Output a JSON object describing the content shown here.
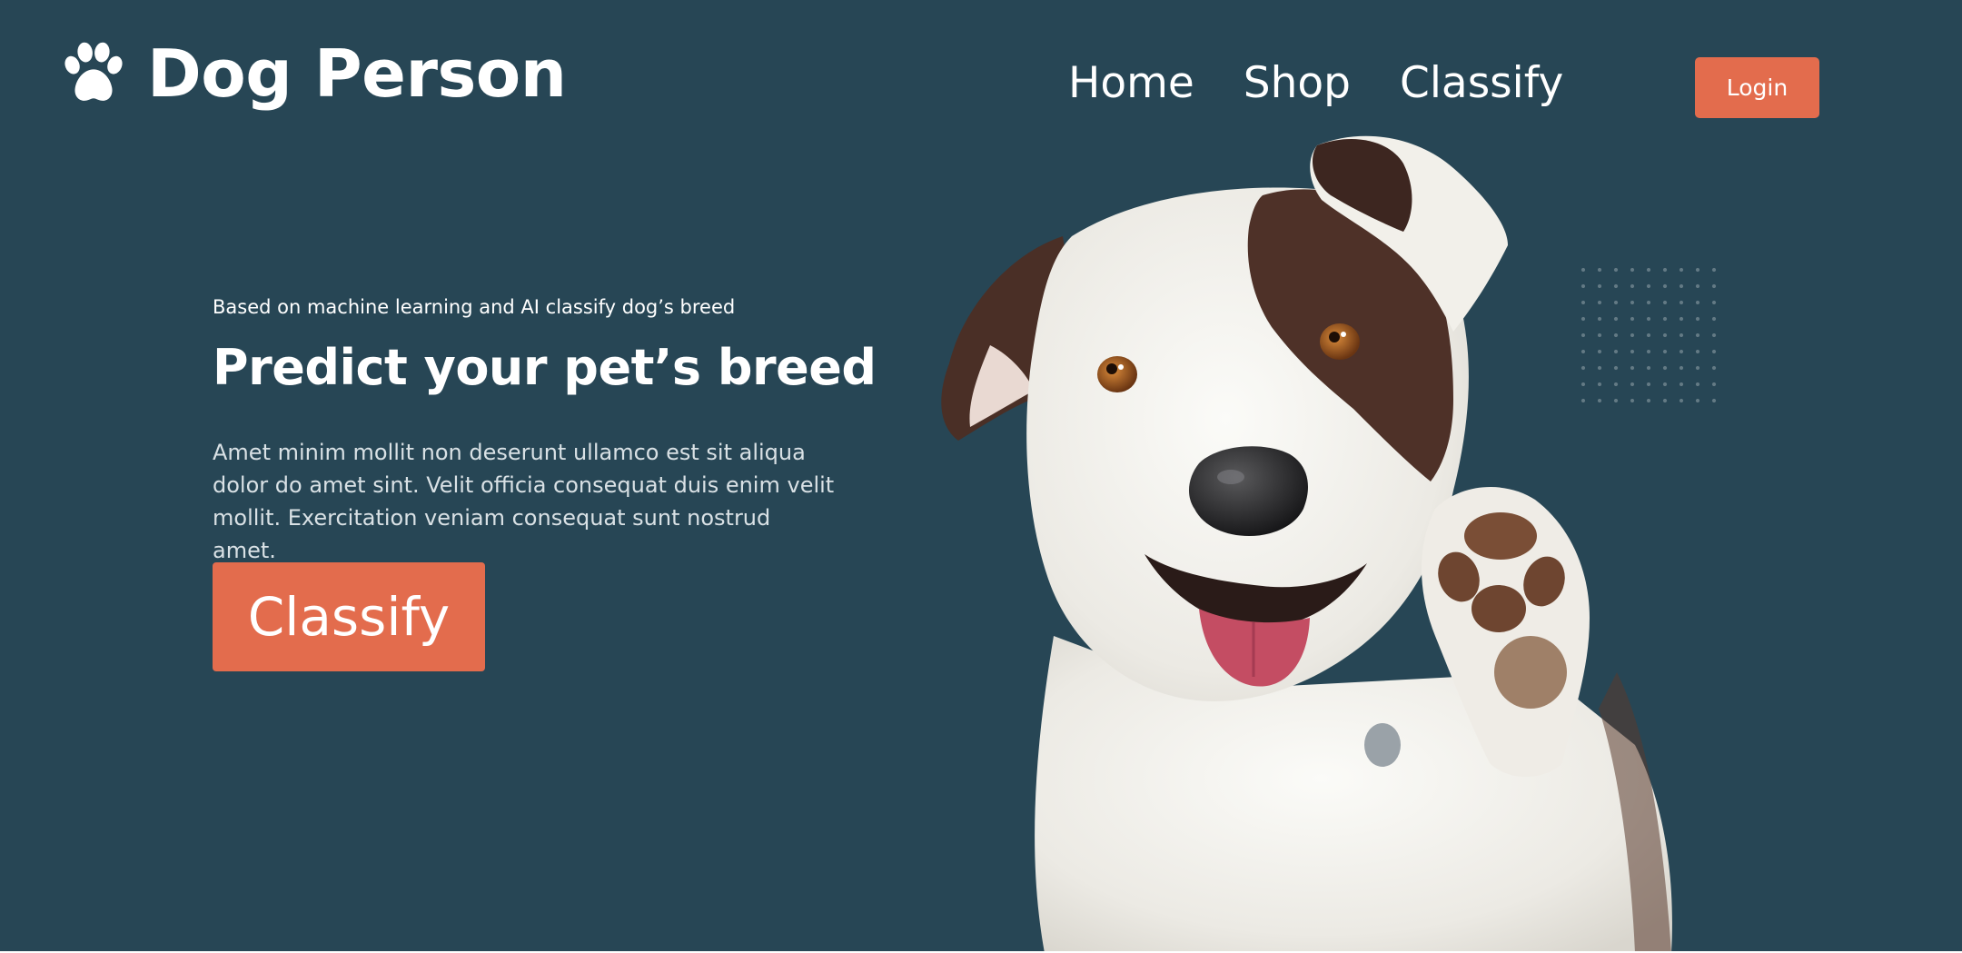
{
  "header": {
    "brand_name": "Dog Person",
    "nav": [
      {
        "label": "Home"
      },
      {
        "label": "Shop"
      },
      {
        "label": "Classify"
      }
    ],
    "login_label": "Login"
  },
  "hero": {
    "subtitle": "Based on machine learning and AI classify dog’s breed",
    "title": "Predict your pet’s breed",
    "body": "Amet minim mollit non deserunt ullamco est sit aliqua dolor do amet sint. Velit officia consequat duis enim velit mollit. Exercitation veniam consequat sunt nostrud amet.",
    "cta_label": "Classify"
  },
  "icons": {
    "logo": "paw-icon",
    "illustration": "dog-waving-paw"
  },
  "colors": {
    "background": "#274655",
    "accent": "#e36c4d",
    "text": "#ffffff"
  }
}
